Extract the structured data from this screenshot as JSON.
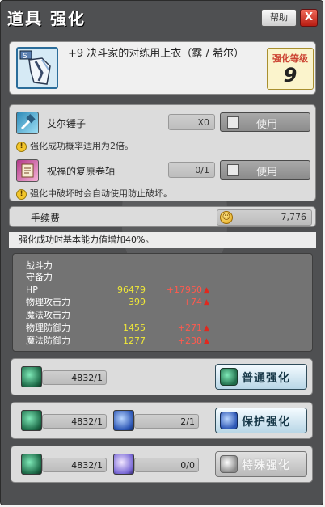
{
  "header": {
    "title": "道具 强化",
    "help_label": "帮助",
    "close_label": "X"
  },
  "item": {
    "name": "+9 决斗家的对练用上衣（露 / 希尔）",
    "level_label": "强化等级",
    "level_value": "9"
  },
  "materials": [
    {
      "name": "艾尔锤子",
      "count": "X0",
      "use_label": "使用",
      "note": "强化成功概率适用为2倍。",
      "icon": "hammer-icon"
    },
    {
      "name": "祝福的复原卷轴",
      "count": "0/1",
      "use_label": "使用",
      "note": "强化中破坏时会自动使用防止破坏。",
      "icon": "scroll-icon"
    }
  ],
  "fee": {
    "label": "手续费",
    "value": "7,776"
  },
  "description": "强化成功时基本能力值增加40%。",
  "stats": [
    {
      "label": "战斗力",
      "value": "",
      "increase": "",
      "arrow": ""
    },
    {
      "label": "守备力",
      "value": "",
      "increase": "",
      "arrow": ""
    },
    {
      "label": "HP",
      "value": "96479",
      "increase": "+17950",
      "arrow": "▲"
    },
    {
      "label": "物理攻击力",
      "value": "399",
      "increase": "+74",
      "arrow": "▲"
    },
    {
      "label": "魔法攻击力",
      "value": "",
      "increase": "",
      "arrow": ""
    },
    {
      "label": "物理防御力",
      "value": "1455",
      "increase": "+271",
      "arrow": "▲"
    },
    {
      "label": "魔法防御力",
      "value": "1277",
      "increase": "+238",
      "arrow": "▲"
    }
  ],
  "enhance_options": [
    {
      "amounts": [
        "4832/1"
      ],
      "button_label": "普通强化",
      "enabled": true
    },
    {
      "amounts": [
        "4832/1",
        "2/1"
      ],
      "button_label": "保护强化",
      "enabled": true
    },
    {
      "amounts": [
        "4832/1",
        "0/0"
      ],
      "button_label": "特殊强化",
      "enabled": false
    }
  ]
}
